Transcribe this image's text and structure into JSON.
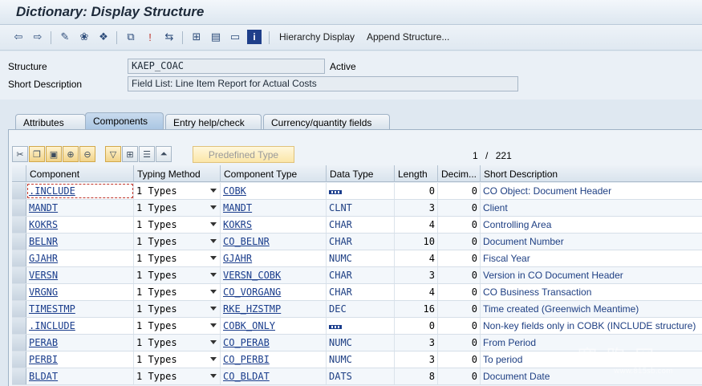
{
  "window": {
    "title": "Dictionary: Display Structure"
  },
  "toolbar": {
    "hierarchy_label": "Hierarchy Display",
    "append_label": "Append Structure...",
    "icons": [
      "back-arrow-icon",
      "forward-arrow-icon",
      "display-change-icon",
      "other-object-icon",
      "activate-icon",
      "where-used-icon",
      "check-icon",
      "navigate-icon",
      "hierarchy-icon",
      "print-icon",
      "object-list-icon",
      "info-icon"
    ]
  },
  "form": {
    "structure_label": "Structure",
    "structure_value": "KAEP_COAC",
    "status": "Active",
    "short_desc_label": "Short Description",
    "short_desc_value": "Field List: Line Item Report for Actual Costs"
  },
  "tabs": [
    {
      "label": "Attributes",
      "active": false
    },
    {
      "label": "Components",
      "active": true
    },
    {
      "label": "Entry help/check",
      "active": false
    },
    {
      "label": "Currency/quantity fields",
      "active": false
    }
  ],
  "table_toolbar": {
    "predefined_label": "Predefined Type",
    "pager_current": "1",
    "pager_sep": "/",
    "pager_total": "221"
  },
  "table": {
    "headers": [
      "Component",
      "Typing Method",
      "Component Type",
      "Data Type",
      "Length",
      "Decim...",
      "Short Description"
    ],
    "rows": [
      {
        "component": ".INCLUDE",
        "typing": "1 Types",
        "ctype": "COBK",
        "dtype": "",
        "length": "0",
        "dec": "0",
        "desc": "CO Object: Document Header"
      },
      {
        "component": "MANDT",
        "typing": "1 Types",
        "ctype": "MANDT",
        "dtype": "CLNT",
        "length": "3",
        "dec": "0",
        "desc": "Client"
      },
      {
        "component": "KOKRS",
        "typing": "1 Types",
        "ctype": "KOKRS",
        "dtype": "CHAR",
        "length": "4",
        "dec": "0",
        "desc": "Controlling Area"
      },
      {
        "component": "BELNR",
        "typing": "1 Types",
        "ctype": "CO_BELNR",
        "dtype": "CHAR",
        "length": "10",
        "dec": "0",
        "desc": "Document Number"
      },
      {
        "component": "GJAHR",
        "typing": "1 Types",
        "ctype": "GJAHR",
        "dtype": "NUMC",
        "length": "4",
        "dec": "0",
        "desc": "Fiscal Year"
      },
      {
        "component": "VERSN",
        "typing": "1 Types",
        "ctype": "VERSN_COBK",
        "dtype": "CHAR",
        "length": "3",
        "dec": "0",
        "desc": "Version in CO Document Header"
      },
      {
        "component": "VRGNG",
        "typing": "1 Types",
        "ctype": "CO_VORGANG",
        "dtype": "CHAR",
        "length": "4",
        "dec": "0",
        "desc": "CO Business Transaction"
      },
      {
        "component": "TIMESTMP",
        "typing": "1 Types",
        "ctype": "RKE_HZSTMP",
        "dtype": "DEC",
        "length": "16",
        "dec": "0",
        "desc": "Time created (Greenwich Meantime)"
      },
      {
        "component": ".INCLUDE",
        "typing": "1 Types",
        "ctype": "COBK_ONLY",
        "dtype": "",
        "length": "0",
        "dec": "0",
        "desc": "Non-key fields only in COBK (INCLUDE structure)"
      },
      {
        "component": "PERAB",
        "typing": "1 Types",
        "ctype": "CO_PERAB",
        "dtype": "NUMC",
        "length": "3",
        "dec": "0",
        "desc": "From Period"
      },
      {
        "component": "PERBI",
        "typing": "1 Types",
        "ctype": "CO_PERBI",
        "dtype": "NUMC",
        "length": "3",
        "dec": "0",
        "desc": "To period"
      },
      {
        "component": "BLDAT",
        "typing": "1 Types",
        "ctype": "CO_BLDAT",
        "dtype": "DATS",
        "length": "8",
        "dec": "0",
        "desc": "Document Date"
      }
    ]
  },
  "watermark": {
    "text": "赛 跑 网",
    "sub": "www.815sb.com"
  }
}
